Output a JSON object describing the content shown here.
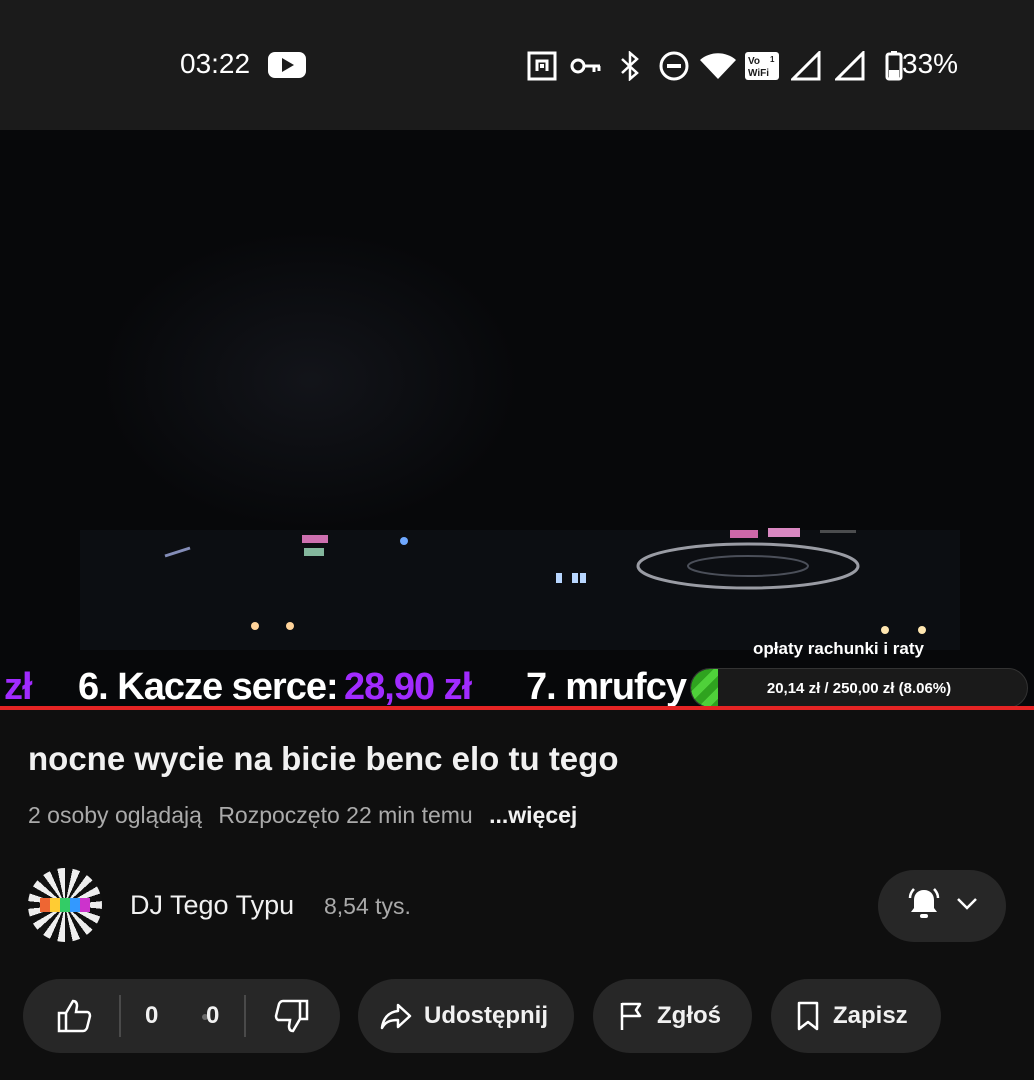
{
  "status_bar": {
    "time": "03:22",
    "battery_percent": "33%",
    "icons": [
      "youtube-notification-icon",
      "nfc-icon",
      "vpn-key-icon",
      "bluetooth-icon",
      "do-not-disturb-icon",
      "wifi-icon",
      "vowifi-icon",
      "signal-icon",
      "signal-icon",
      "battery-icon"
    ],
    "vowifi_text": "Vo WiFi",
    "vowifi_num": "1"
  },
  "video": {
    "ticker": {
      "part1_currency": "zł",
      "item6_label": "6. Kacze serce:",
      "item6_amount": "28,90 zł",
      "item7_label": "7. mrufcy"
    },
    "goal": {
      "title": "opłaty rachunki i raty",
      "text": "20,14 zł / 250,00 zł (8.06%)",
      "fraction": 0.0806
    },
    "playback_fraction": 1.0
  },
  "details": {
    "title": "nocne wycie na bicie benc elo tu tego",
    "viewers": "2 osoby oglądają",
    "started": "Rozpoczęto 22 min temu",
    "more": "...więcej"
  },
  "channel": {
    "name": "DJ Tego Typu",
    "subscribers": "8,54 tys."
  },
  "actions": {
    "likes": "0",
    "dislikes": "0",
    "share": "Udostępnij",
    "report": "Zgłoś",
    "save": "Zapisz"
  },
  "colors": {
    "background": "#0f0f0f",
    "pill": "#272727",
    "progress": "#e52424",
    "ticker_amount": "#a12bff",
    "goal_fill": "#4fd13a"
  }
}
